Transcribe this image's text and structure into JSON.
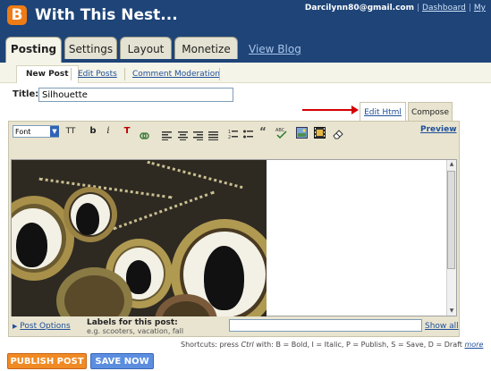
{
  "header": {
    "logo_letter": "B",
    "blog_title": "With This Nest...",
    "user_email": "Darcilynn80@gmail.com",
    "link_dashboard": "Dashboard",
    "link_my": "My"
  },
  "tabs": [
    {
      "label": "Posting",
      "active": true
    },
    {
      "label": "Settings",
      "active": false
    },
    {
      "label": "Layout",
      "active": false
    },
    {
      "label": "Monetize",
      "active": false
    }
  ],
  "view_blog": "View Blog",
  "subnav": {
    "new_post": "New Post",
    "edit_posts": "Edit Posts",
    "comment_moderation": "Comment Moderation"
  },
  "post": {
    "title_label": "Title:",
    "title_value": "Silhouette"
  },
  "mode_tabs": {
    "edit_html": "Edit Html",
    "compose": "Compose"
  },
  "toolbar": {
    "font_label": "Font",
    "font_size_icon": "TT",
    "bold": "b",
    "italic": "i",
    "text_color": "T",
    "preview": "Preview"
  },
  "bottom": {
    "post_options": "Post Options",
    "labels_label": "Labels for this post:",
    "labels_hint": "e.g. scooters, vacation, fall",
    "labels_value": "",
    "show_all": "Show all",
    "shortcuts_prefix": "Shortcuts: press",
    "shortcuts_ctrl": "Ctrl",
    "shortcuts_text": "with: B = Bold, I = Italic, P = Publish, S = Save, D = Draft",
    "shortcuts_more": "more"
  },
  "buttons": {
    "publish": "PUBLISH POST",
    "save": "SAVE NOW"
  },
  "colors": {
    "header_bg": "#1e4478",
    "tab_bg": "#e4e2d2",
    "publish": "#f08a24",
    "save": "#5c8ee0",
    "annotation_arrow": "#d40000"
  }
}
